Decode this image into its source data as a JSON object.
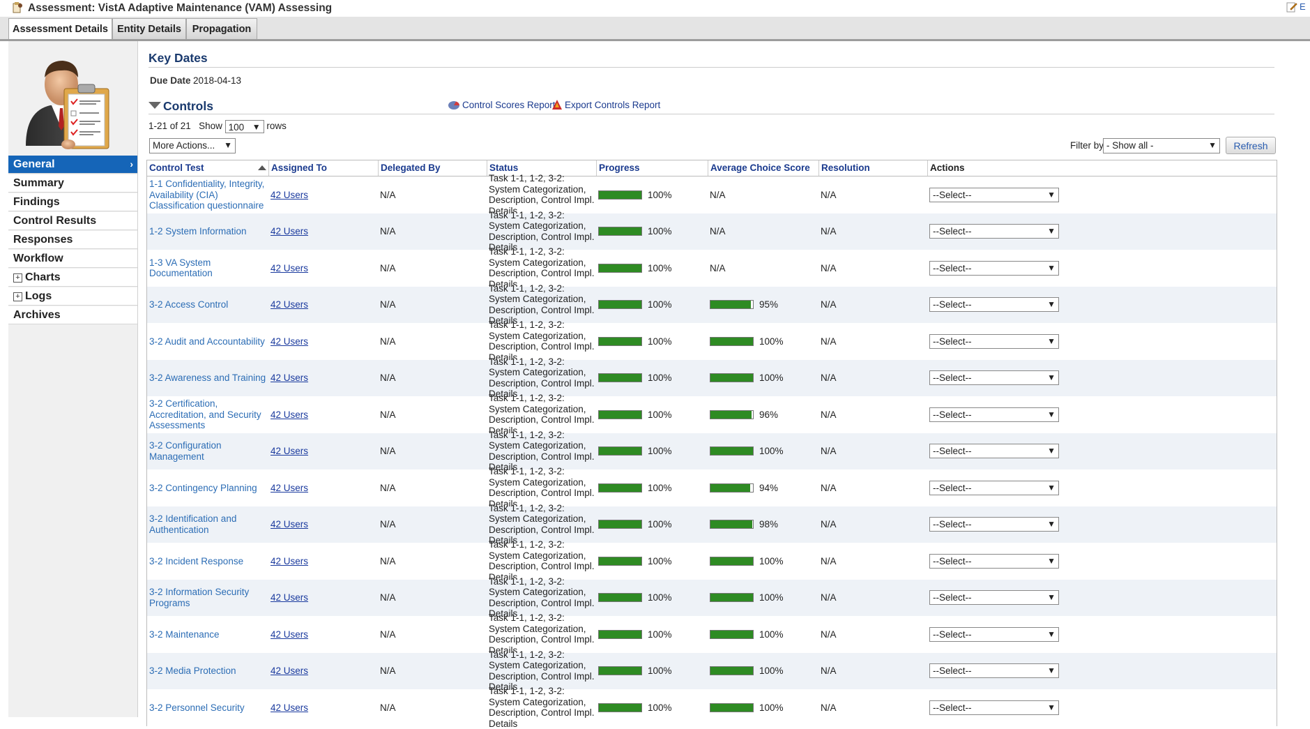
{
  "window": {
    "title": "Assessment: VistA Adaptive Maintenance (VAM) Assessing",
    "edit_label": "E"
  },
  "tabs": [
    {
      "label": "Assessment Details",
      "active": true
    },
    {
      "label": "Entity Details",
      "active": false
    },
    {
      "label": "Propagation",
      "active": false
    }
  ],
  "sidebar": {
    "items": [
      {
        "label": "General",
        "active": true,
        "expandable": false
      },
      {
        "label": "Summary",
        "active": false,
        "expandable": false
      },
      {
        "label": "Findings",
        "active": false,
        "expandable": false
      },
      {
        "label": "Control Results",
        "active": false,
        "expandable": false
      },
      {
        "label": "Responses",
        "active": false,
        "expandable": false
      },
      {
        "label": "Workflow",
        "active": false,
        "expandable": false
      },
      {
        "label": "Charts",
        "active": false,
        "expandable": true
      },
      {
        "label": "Logs",
        "active": false,
        "expandable": true
      },
      {
        "label": "Archives",
        "active": false,
        "expandable": false
      }
    ],
    "expand_symbol": "+",
    "active_arrow": "›"
  },
  "key_dates": {
    "heading": "Key Dates",
    "due_label": "Due Date",
    "due_value": "2018-04-13"
  },
  "controls": {
    "heading": "Controls",
    "report_links": [
      {
        "label": "Control Scores Report",
        "icon": "chart-report-icon"
      },
      {
        "label": "Export Controls Report",
        "icon": "export-report-icon"
      }
    ],
    "pager": {
      "range": "1-21 of 21",
      "show_label": "Show",
      "rows_value": "100",
      "rows_label": "rows"
    },
    "more_actions": "More Actions...",
    "filter_label": "Filter by",
    "filter_value": "- Show all -",
    "refresh_label": "Refresh"
  },
  "table": {
    "columns": [
      "Control Test",
      "Assigned To",
      "Delegated By",
      "Status",
      "Progress",
      "Average Choice Score",
      "Resolution",
      "Actions"
    ],
    "status_text": "Task 1-1, 1-2, 3-2: System Categorization, Description, Control Impl. Details",
    "action_placeholder": "--Select--",
    "rows": [
      {
        "control": "1-1 Confidentiality, Integrity, Availability (CIA) Classification questionnaire",
        "assigned": "42 Users",
        "delegated": "N/A",
        "progress": 100,
        "progress_text": "100%",
        "score": null,
        "score_text": "N/A",
        "resolution": "N/A"
      },
      {
        "control": "1-2 System Information",
        "assigned": "42 Users",
        "delegated": "N/A",
        "progress": 100,
        "progress_text": "100%",
        "score": null,
        "score_text": "N/A",
        "resolution": "N/A"
      },
      {
        "control": "1-3 VA System Documentation",
        "assigned": "42 Users",
        "delegated": "N/A",
        "progress": 100,
        "progress_text": "100%",
        "score": null,
        "score_text": "N/A",
        "resolution": "N/A"
      },
      {
        "control": "3-2 Access Control",
        "assigned": "42 Users",
        "delegated": "N/A",
        "progress": 100,
        "progress_text": "100%",
        "score": 95,
        "score_text": "95%",
        "resolution": "N/A"
      },
      {
        "control": "3-2 Audit and Accountability",
        "assigned": "42 Users",
        "delegated": "N/A",
        "progress": 100,
        "progress_text": "100%",
        "score": 100,
        "score_text": "100%",
        "resolution": "N/A"
      },
      {
        "control": "3-2 Awareness and Training",
        "assigned": "42 Users",
        "delegated": "N/A",
        "progress": 100,
        "progress_text": "100%",
        "score": 100,
        "score_text": "100%",
        "resolution": "N/A"
      },
      {
        "control": "3-2 Certification, Accreditation, and Security Assessments",
        "assigned": "42 Users",
        "delegated": "N/A",
        "progress": 100,
        "progress_text": "100%",
        "score": 96,
        "score_text": "96%",
        "resolution": "N/A"
      },
      {
        "control": "3-2 Configuration Management",
        "assigned": "42 Users",
        "delegated": "N/A",
        "progress": 100,
        "progress_text": "100%",
        "score": 100,
        "score_text": "100%",
        "resolution": "N/A"
      },
      {
        "control": "3-2 Contingency Planning",
        "assigned": "42 Users",
        "delegated": "N/A",
        "progress": 100,
        "progress_text": "100%",
        "score": 94,
        "score_text": "94%",
        "resolution": "N/A"
      },
      {
        "control": "3-2 Identification and Authentication",
        "assigned": "42 Users",
        "delegated": "N/A",
        "progress": 100,
        "progress_text": "100%",
        "score": 98,
        "score_text": "98%",
        "resolution": "N/A"
      },
      {
        "control": "3-2 Incident Response",
        "assigned": "42 Users",
        "delegated": "N/A",
        "progress": 100,
        "progress_text": "100%",
        "score": 100,
        "score_text": "100%",
        "resolution": "N/A"
      },
      {
        "control": "3-2 Information Security Programs",
        "assigned": "42 Users",
        "delegated": "N/A",
        "progress": 100,
        "progress_text": "100%",
        "score": 100,
        "score_text": "100%",
        "resolution": "N/A"
      },
      {
        "control": "3-2 Maintenance",
        "assigned": "42 Users",
        "delegated": "N/A",
        "progress": 100,
        "progress_text": "100%",
        "score": 100,
        "score_text": "100%",
        "resolution": "N/A"
      },
      {
        "control": "3-2 Media Protection",
        "assigned": "42 Users",
        "delegated": "N/A",
        "progress": 100,
        "progress_text": "100%",
        "score": 100,
        "score_text": "100%",
        "resolution": "N/A"
      },
      {
        "control": "3-2 Personnel Security",
        "assigned": "42 Users",
        "delegated": "N/A",
        "progress": 100,
        "progress_text": "100%",
        "score": 100,
        "score_text": "100%",
        "resolution": "N/A"
      }
    ]
  },
  "colors": {
    "accent": "#1565b8",
    "progress_fill": "#2e8b23",
    "link": "#2c6db5",
    "heading": "#1a3a6e"
  }
}
